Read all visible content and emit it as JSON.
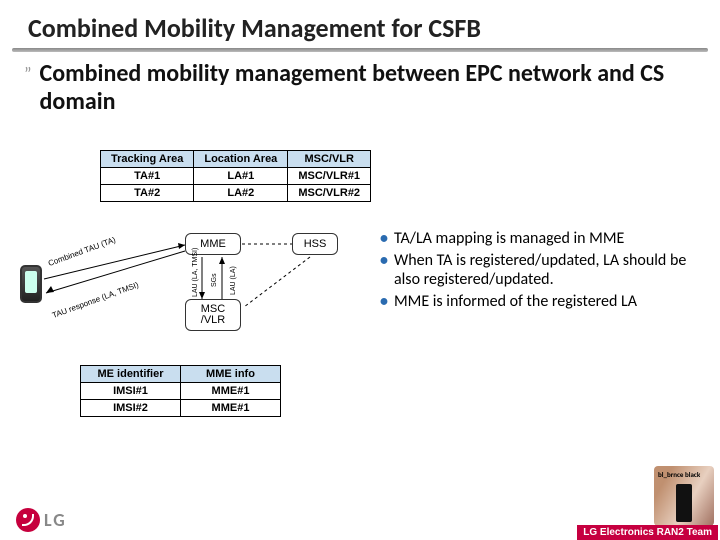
{
  "slide": {
    "title": "Combined Mobility Management for CSFB",
    "main_bullet": "Combined mobility management between EPC network and CS domain"
  },
  "map_table": {
    "headers": [
      "Tracking Area",
      "Location Area",
      "MSC/VLR"
    ],
    "rows": [
      [
        "TA#1",
        "LA#1",
        "MSC/VLR#1"
      ],
      [
        "TA#2",
        "LA#2",
        "MSC/VLR#2"
      ]
    ]
  },
  "me_table": {
    "headers": [
      "ME identifier",
      "MME  info"
    ],
    "rows": [
      [
        "IMSI#1",
        "MME#1"
      ],
      [
        "IMSI#2",
        "MME#1"
      ]
    ]
  },
  "diagram": {
    "mme": "MME",
    "msc": "MSC /VLR",
    "hss": "HSS",
    "lbl_combined_tau": "Combined TAU (TA)",
    "lbl_tau_resp": "TAU response (LA, TMSI)",
    "lbl_lau_la_tmsi": "LAU (LA, TMSI)",
    "lbl_sgs": "SGs",
    "lbl_lau_la": "LAU (LA)"
  },
  "notes": [
    "TA/LA mapping is managed in MME",
    "When TA is registered/updated, LA should be also registered/updated.",
    "MME is informed of the registered LA"
  ],
  "footer": {
    "logo_text": "LG",
    "right_text": "LG Electronics RAN2 Team",
    "phone_caption": "bl_brnce black"
  }
}
